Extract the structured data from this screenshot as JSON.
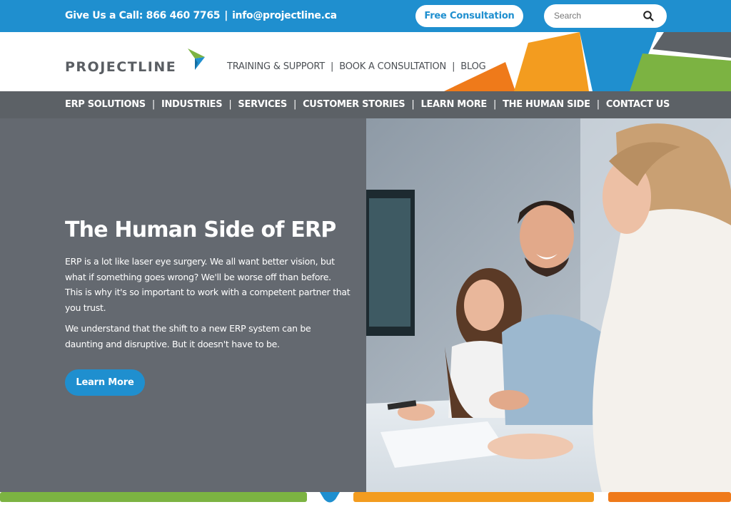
{
  "topbar": {
    "call_label": "Give Us a Call: 866 460 7765",
    "separator": "|",
    "email": "info@projectline.ca",
    "consult_button": "Free Consultation",
    "search_placeholder": "Search"
  },
  "header": {
    "logo_text": "PROJECTLINE",
    "utility_nav": [
      "TRAINING & SUPPORT",
      "BOOK A CONSULTATION",
      "BLOG"
    ]
  },
  "main_nav": [
    "ERP SOLUTIONS",
    "INDUSTRIES",
    "SERVICES",
    "CUSTOMER STORIES",
    "LEARN MORE",
    "THE HUMAN SIDE",
    "CONTACT US"
  ],
  "hero": {
    "title": "The Human Side of ERP",
    "paragraph1": "ERP is a lot like laser eye surgery. We all want better vision, but what if something goes wrong? We'll be worse off than before. This is why it's so important to work with a competent partner that you trust.",
    "paragraph2": "We understand that the shift to a new ERP system can be daunting and disruptive. But it doesn't have to be.",
    "cta": "Learn More"
  },
  "colors": {
    "brand_blue": "#1f8fcf",
    "nav_gray": "#5c6166",
    "hero_gray": "#646970",
    "green": "#7cb342",
    "orange": "#f39c1f",
    "dark_orange": "#ef7a1a"
  },
  "icons": {
    "search": "search-icon",
    "logo_mark": "logo-arrow-icon"
  }
}
